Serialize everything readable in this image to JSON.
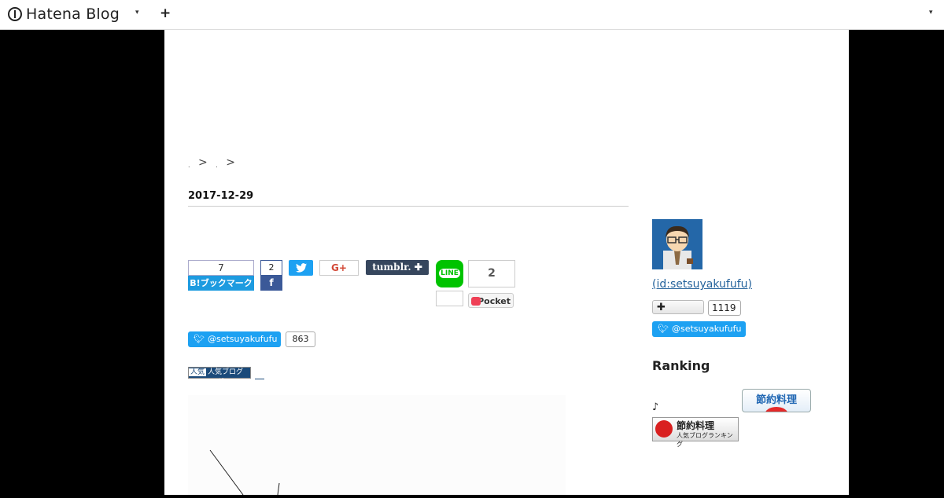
{
  "header": {
    "brand": "Hatena Blog",
    "menu_caret": "▾",
    "add_label": "+",
    "right_caret": "▾"
  },
  "breadcrumb": {
    "sep1": ">",
    "sep2": ">"
  },
  "entry": {
    "date": "2017-12-29"
  },
  "share": {
    "hatena_count": "7",
    "hatena_label": "B!ブックマーク",
    "facebook_count": "2",
    "facebook_icon": "f",
    "twitter_icon": "twitter-bird",
    "googleplus_label": "G+",
    "tumblr_label": "tumblr. ✚",
    "line_label": "LINE",
    "pocket_count": "2",
    "pocket_label": "Pocket"
  },
  "twitter_follow_main": {
    "label": "@setsuyakufufu",
    "count": "863"
  },
  "ranking_banner": {
    "label": "人気ブログランキング"
  },
  "sidebar": {
    "profile_id": "(id:setsuyakufufu)",
    "subscribe_label": "✚",
    "subscribe_count": "1119",
    "twitter_label": "@setsuyakufufu",
    "ranking_title": "Ranking",
    "note": "♪",
    "setsuyaku_banner1": "節約料理",
    "setsuyaku_banner2_title": "節約料理",
    "setsuyaku_banner2_sub": "人気ブログランキング"
  },
  "colors": {
    "hatena_blue": "#1d9be0",
    "facebook": "#3b5998",
    "twitter": "#1da1f2",
    "tumblr": "#36465d",
    "line": "#00c300",
    "pocket": "#ef4056"
  }
}
